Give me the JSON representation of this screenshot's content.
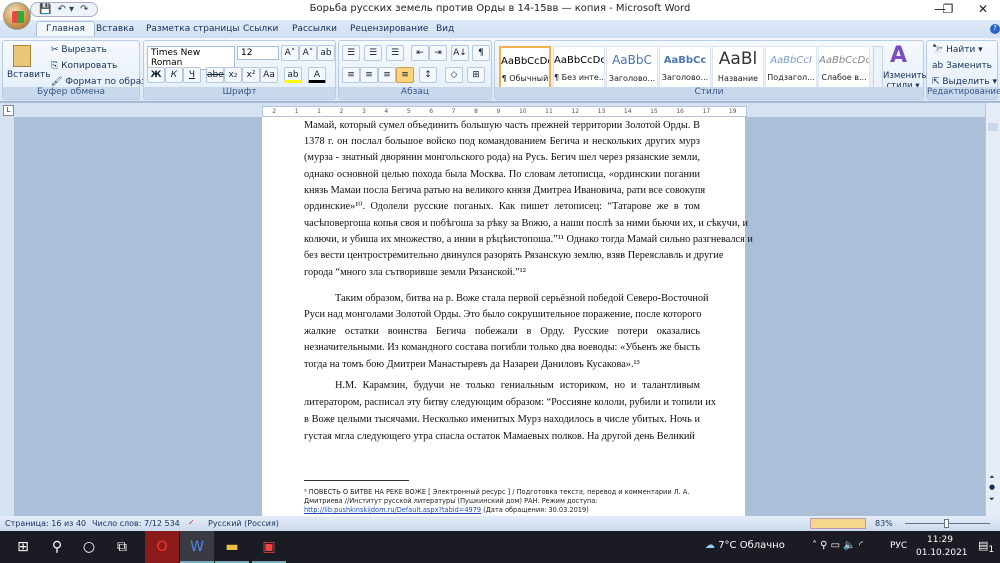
{
  "window": {
    "title": "Борьба русских земель  против Орды в 14-15вв — копия  -  Microsoft Word",
    "minimize": "—",
    "maximize": "❐",
    "close": "✕"
  },
  "qat": {
    "save": "💾",
    "undo": "↶ ▾",
    "redo": "↷",
    "more": "₹"
  },
  "tabs": [
    "Главная",
    "Вставка",
    "Разметка страницы",
    "Ссылки",
    "Рассылки",
    "Рецензирование",
    "Вид"
  ],
  "clipboard": {
    "paste": "Вставить",
    "cut": "Вырезать",
    "copy": "Копировать",
    "format_painter": "Формат по образцу",
    "label": "Буфер обмена"
  },
  "font": {
    "name": "Times New Roman",
    "size": "12",
    "label": "Шрифт",
    "grow": "A˄",
    "shrink": "A˅",
    "clear": "ab",
    "bold": "Ж",
    "italic": "К",
    "underline": "Ч",
    "strike": "abe",
    "sub": "x₂",
    "sup": "x²",
    "case": "Aa",
    "highlight": "ab",
    "color": "A"
  },
  "paragraph": {
    "label": "Абзац",
    "pilcrow": "¶",
    "sort": "А↓"
  },
  "styles": {
    "label": "Стили",
    "items": [
      {
        "preview": "AaBbCcDc",
        "name": "¶ Обычный"
      },
      {
        "preview": "AaBbCcDc",
        "name": "¶ Без инте..."
      },
      {
        "preview": "AaBbC",
        "name": "Заголово..."
      },
      {
        "preview": "AaBbCc",
        "name": "Заголово..."
      },
      {
        "preview": "AaBl",
        "name": "Название"
      },
      {
        "preview": "AaBbCcI",
        "name": "Подзагол..."
      },
      {
        "preview": "AaBbCcDc",
        "name": "Слабое в..."
      }
    ],
    "change": "Изменить стили ▾"
  },
  "editing": {
    "label": "Редактирование",
    "find": "Найти ▾",
    "replace": "Заменить",
    "select": "Выделить ▾"
  },
  "ruler": [
    "2",
    "1",
    "1",
    "2",
    "3",
    "4",
    "5",
    "6",
    "7",
    "8",
    "9",
    "10",
    "11",
    "12",
    "13",
    "14",
    "15",
    "16",
    "17",
    "19"
  ],
  "document": {
    "p1": [
      "Мамай, который сумел объединить большую часть прежней территории Золотой Орды. В",
      "1378 г. он послал большое войско под командованием Бегича и нескольких других мурз",
      "(мурза - знатный дворянин монгольского рода) на Русь. Бегич шел через рязанские земли,",
      "однако основной целью похода была Москва. По словам летописца, «ординскии погании",
      "князь Мамаи посла Бегича ратью на великого князя Дмитреа Ивановича, рати все совокупя",
      "ординские»¹⁰. Одолели русские поганых. Как пишет летописец: “Татарове же в том",
      "часѣповергоша копья своя и побѣгоша за рѣку за Вожю, а наши послѣ за ними бьючи их, и сѣкучи, и",
      "колючи, и убиша их множество, а инии в рѣцѣистопоша.”¹¹  Однако тогда Мамай сильно разгневался и",
      "без вести центростремительно двинулся разорять Рязанскую землю, взяв Переяславль и другие",
      "города “много зла сътворивше земли Рязанской.”¹²"
    ],
    "p2": [
      "Таким образом, битва на р. Воже стала первой серьёзной победой Северо-Восточной",
      "Руси над монголами Золотой Орды. Это было сокрушительное поражение, после которого",
      "жалкие остатки воинства Бегича побежали в Орду. Русские потери оказались",
      "незначительными. Из командного состава погибли только два воеводы: «Убьенъ же бысть",
      "тогда на томъ бою Дмитреи Манастыревъ да Назареи Даниловъ Кусакова».¹³"
    ],
    "p3": [
      "Н.М. Карамзин, будучи не только гениальным историком, но и талантливым",
      "литератором, расписал эту битву следующим образом: “Россияне кололи, рубили и топили их",
      "в Воже целыми тысячами. Несколько именитых Мурз находилось в числе убитых. Ночь и",
      "густая мгла следующего утра спасла остаток Мамаевых полков. На другой день Великий"
    ],
    "footnote": {
      "text1": "⁹ ПОВЕСТЬ О БИТВЕ НА РЕКЕ ВОЖЕ [ Электронный ресурс ] / Подготовка текста, перевод и комментарии Л. А.",
      "text2": "Дмитриева //Институт русской литературы (Пушкинский дом) РАН. Режим доступа:",
      "link": "http://lib.pushkinskijdom.ru/Default.aspx?tabid=4979",
      "date": " (Дата обращения: 30.03.2019)"
    }
  },
  "status": {
    "page": "Страница: 16 из 40",
    "words": "Число слов: 7/12 534",
    "language": "Русский (Россия)",
    "zoom": "83%"
  },
  "taskbar": {
    "weather": "7°C  Облачно",
    "lang": "РУС",
    "time": "11:29",
    "date": "01.10.2021",
    "notifications": "1"
  }
}
